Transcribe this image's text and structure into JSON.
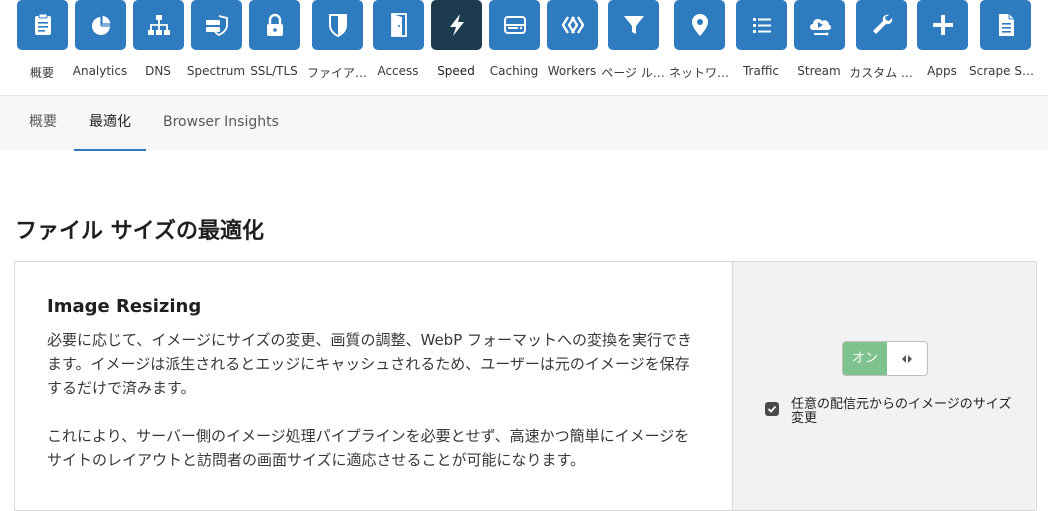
{
  "nav": {
    "items": [
      {
        "label": "概要",
        "icon": "clipboard-icon"
      },
      {
        "label": "Analytics",
        "icon": "pie-chart-icon"
      },
      {
        "label": "DNS",
        "icon": "sitemap-icon"
      },
      {
        "label": "Spectrum",
        "icon": "server-shield-icon"
      },
      {
        "label": "SSL/TLS",
        "icon": "lock-icon"
      },
      {
        "label": "ファイア…",
        "icon": "shield-icon"
      },
      {
        "label": "Access",
        "icon": "door-icon"
      },
      {
        "label": "Speed",
        "icon": "lightning-icon"
      },
      {
        "label": "Caching",
        "icon": "drive-icon"
      },
      {
        "label": "Workers",
        "icon": "workers-icon"
      },
      {
        "label": "ページ ル…",
        "icon": "filter-icon"
      },
      {
        "label": "ネットワ…",
        "icon": "location-pin-icon"
      },
      {
        "label": "Traffic",
        "icon": "list-icon"
      },
      {
        "label": "Stream",
        "icon": "cloud-play-icon"
      },
      {
        "label": "カスタム …",
        "icon": "wrench-icon"
      },
      {
        "label": "Apps",
        "icon": "plus-icon"
      },
      {
        "label": "Scrape Sh…",
        "icon": "document-icon"
      }
    ],
    "active_index": 7
  },
  "subnav": {
    "tabs": [
      {
        "label": "概要"
      },
      {
        "label": "最適化"
      },
      {
        "label": "Browser Insights"
      }
    ],
    "active_index": 1
  },
  "section": {
    "title": "ファイル サイズの最適化"
  },
  "card": {
    "title": "Image Resizing",
    "desc_1": "必要に応じて、イメージにサイズの変更、画質の調整、WebP フォーマットへの変換を実行できます。イメージは派生されるとエッジにキャッシュされるため、ユーザーは元のイメージを保存するだけで済みます。",
    "desc_2": "これにより、サーバー側のイメージ処理パイプラインを必要とせず、高速かつ簡単にイメージをサイトのレイアウトと訪問者の画面サイズに適応させることが可能になります。",
    "toggle_label": "オン",
    "toggle_state": "on",
    "option_label": "任意の配信元からのイメージのサイズ変更",
    "option_checked": true
  },
  "colors": {
    "nav_tile": "#2f7bbf",
    "nav_tile_active": "#1d3b4f",
    "toggle_on": "#7ec28e",
    "tab_underline": "#2f7bbf"
  }
}
